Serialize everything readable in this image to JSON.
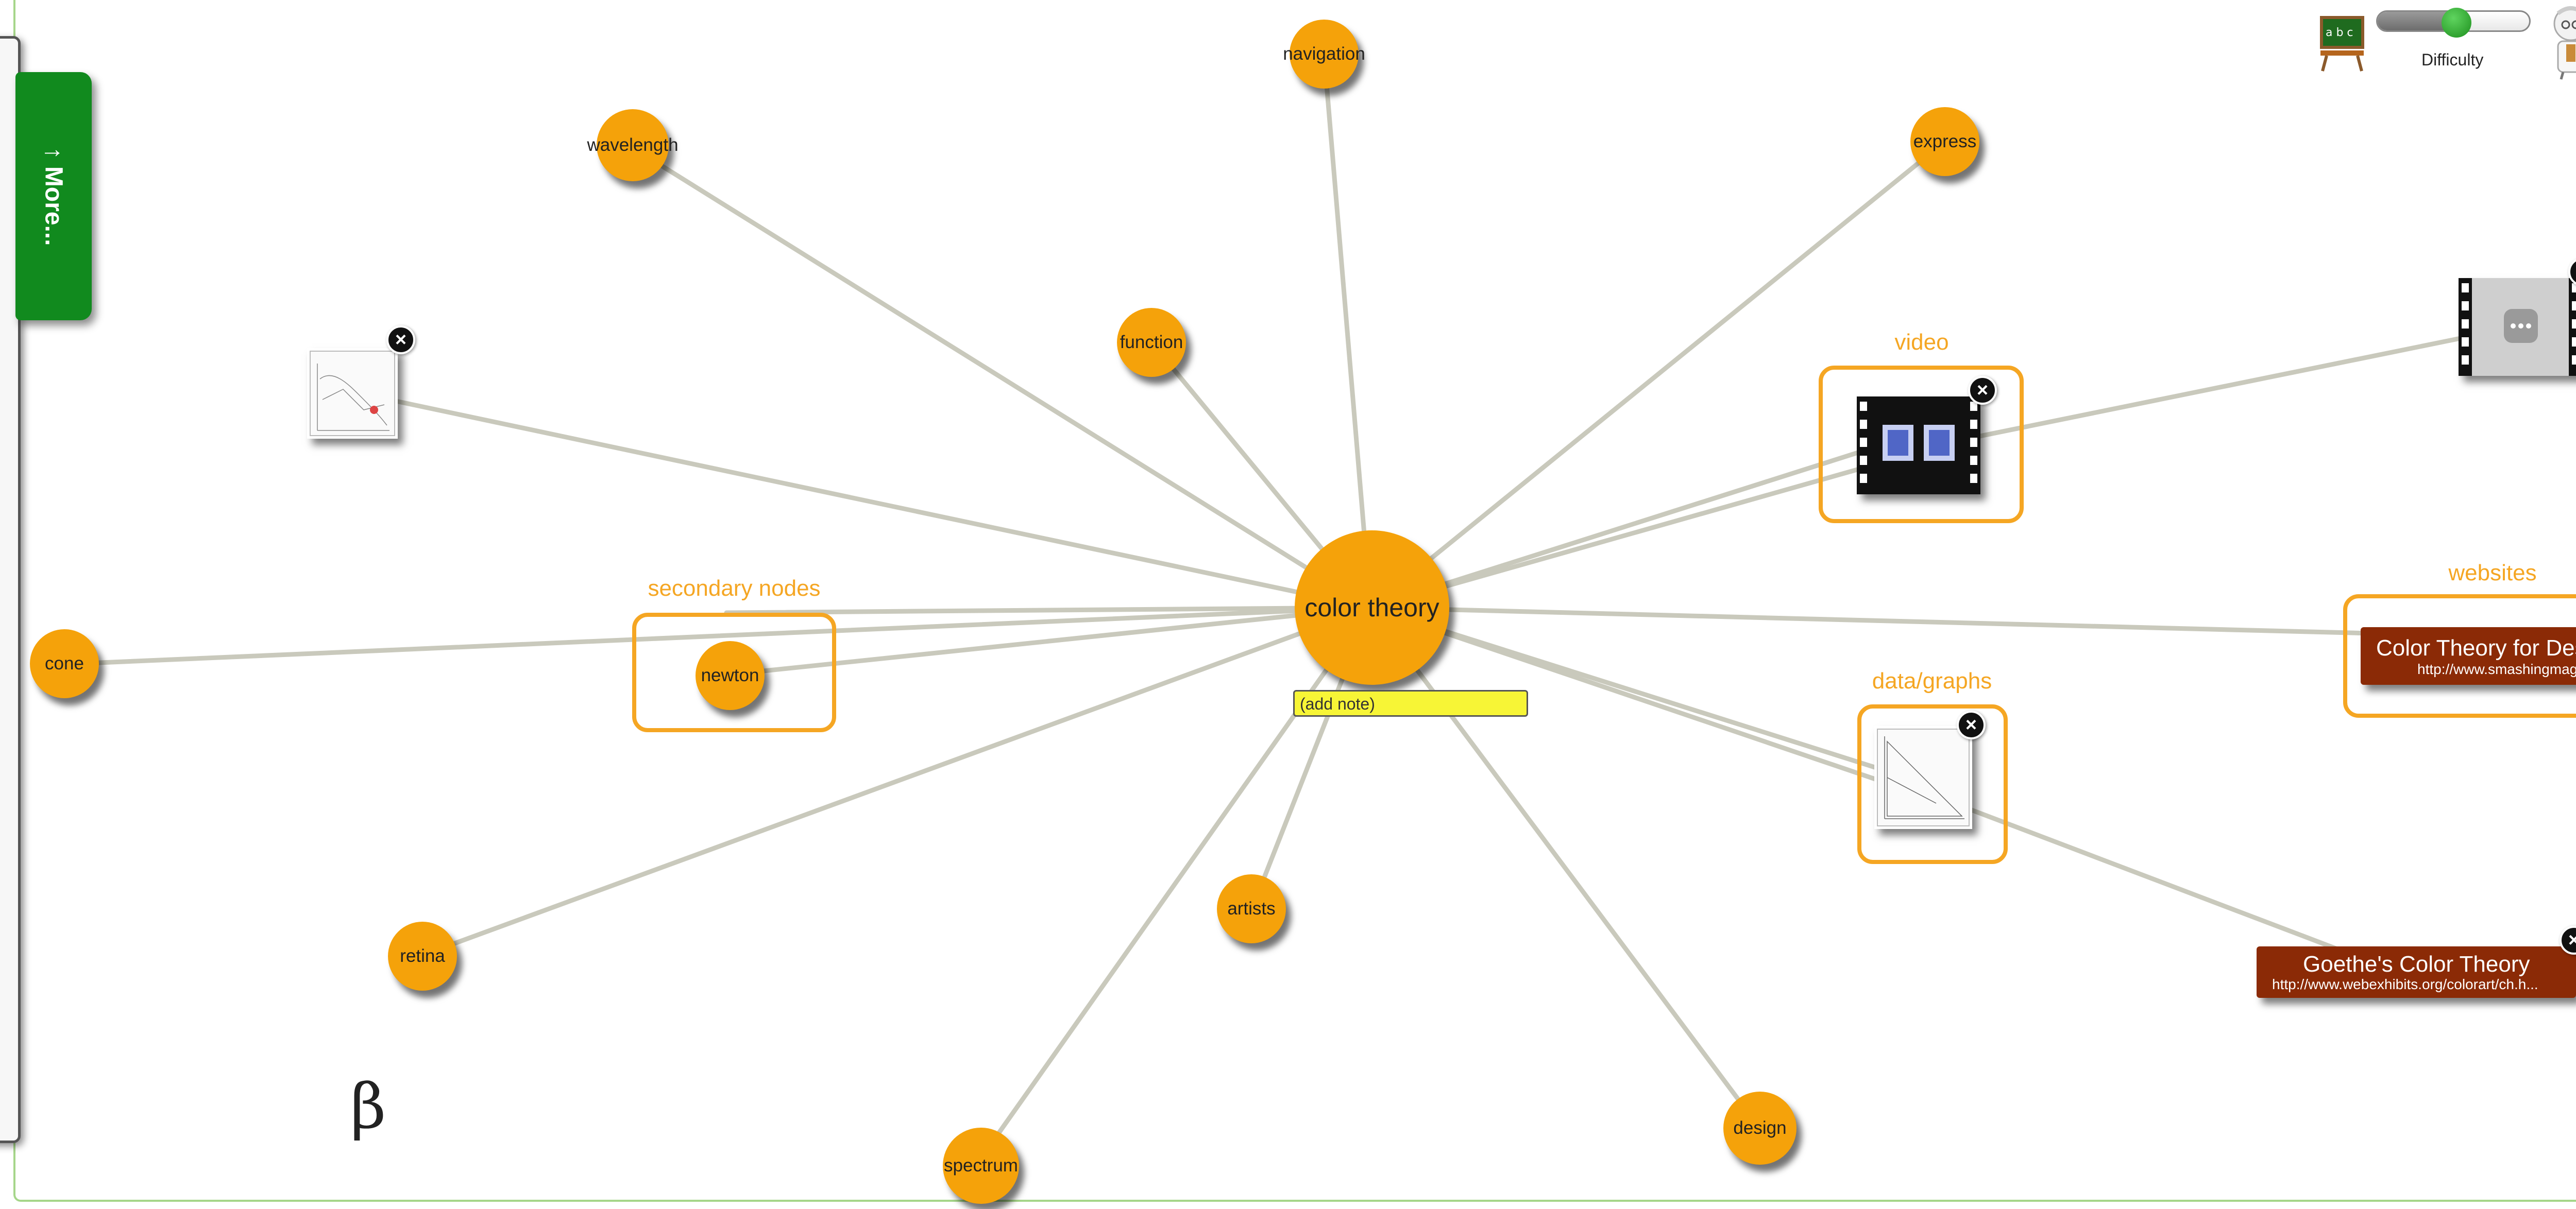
{
  "side_panel": {
    "more_label": "↑ More..."
  },
  "center_node": {
    "label": "color theory",
    "note_placeholder": "(add note)"
  },
  "nodes": [
    {
      "label": "navigation"
    },
    {
      "label": "wavelength"
    },
    {
      "label": "express"
    },
    {
      "label": "function"
    },
    {
      "label": "cone"
    },
    {
      "label": "newton"
    },
    {
      "label": "retina"
    },
    {
      "label": "artists"
    },
    {
      "label": "spectrum"
    },
    {
      "label": "design"
    }
  ],
  "groups": {
    "secondary": "secondary nodes",
    "video": "video",
    "data": "data/graphs",
    "websites": "websites"
  },
  "websites": [
    {
      "title": "Color Theory for Designer",
      "url": "http://www.smashingmagazine"
    },
    {
      "title": "Goethe's Color Theory",
      "url": "http://www.webexhibits.org/colorart/ch.h..."
    }
  ],
  "difficulty": {
    "label": "Difficulty",
    "level": 0.52,
    "teacher_sign": "a b c"
  },
  "misc": {
    "beta_symbol": "β"
  },
  "colors": {
    "node": "#f5a20a",
    "group_box": "#f5a623",
    "edge": "#c9c9bc",
    "more_tab": "#118a1e",
    "site_card": "#8b2a06"
  },
  "icons": {
    "close": "close-icon",
    "video": "film-strip-icon",
    "teacher": "chalkboard-icon",
    "professor": "professor-icon"
  }
}
